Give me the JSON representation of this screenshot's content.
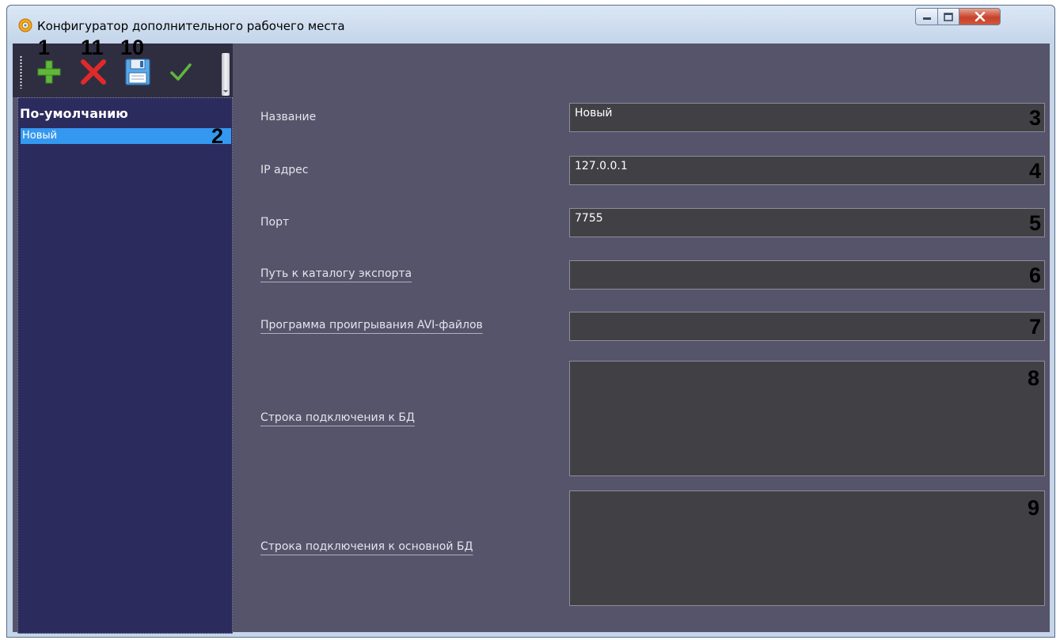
{
  "window": {
    "title": "Конфигуратор дополнительного рабочего места"
  },
  "toolbar": {
    "buttons": [
      {
        "icon": "add-icon",
        "color": "#5fb83a"
      },
      {
        "icon": "delete-icon",
        "color": "#e02a2a"
      },
      {
        "icon": "save-icon",
        "color": "#5aa8e6"
      },
      {
        "icon": "apply-icon",
        "color": "#5fb83a"
      }
    ]
  },
  "tree": {
    "group_label": "По-умолчанию",
    "items": [
      {
        "label": "Новый",
        "selected": true
      }
    ]
  },
  "form": {
    "fields": [
      {
        "label": "Название",
        "value": "Новый"
      },
      {
        "label": "IP адрес",
        "value": "127.0.0.1"
      },
      {
        "label": "Порт",
        "value": "7755"
      },
      {
        "label": "Путь к каталогу экспорта",
        "value": ""
      },
      {
        "label": "Программа проигрывания AVI-файлов",
        "value": ""
      },
      {
        "label": "Строка подключения к БД",
        "value": ""
      },
      {
        "label": "Строка подключения к основной БД",
        "value": ""
      }
    ]
  },
  "annotations": {
    "n1": "1",
    "n2": "2",
    "n3": "3",
    "n4": "4",
    "n5": "5",
    "n6": "6",
    "n7": "7",
    "n8": "8",
    "n9": "9",
    "n10": "10",
    "n11": "11"
  },
  "colors": {
    "client_bg": "#56546a",
    "tree_bg": "#2c2b5e",
    "selection": "#3498f0",
    "input_bg": "#414045",
    "toolbar_bg": "#2f2e40"
  }
}
